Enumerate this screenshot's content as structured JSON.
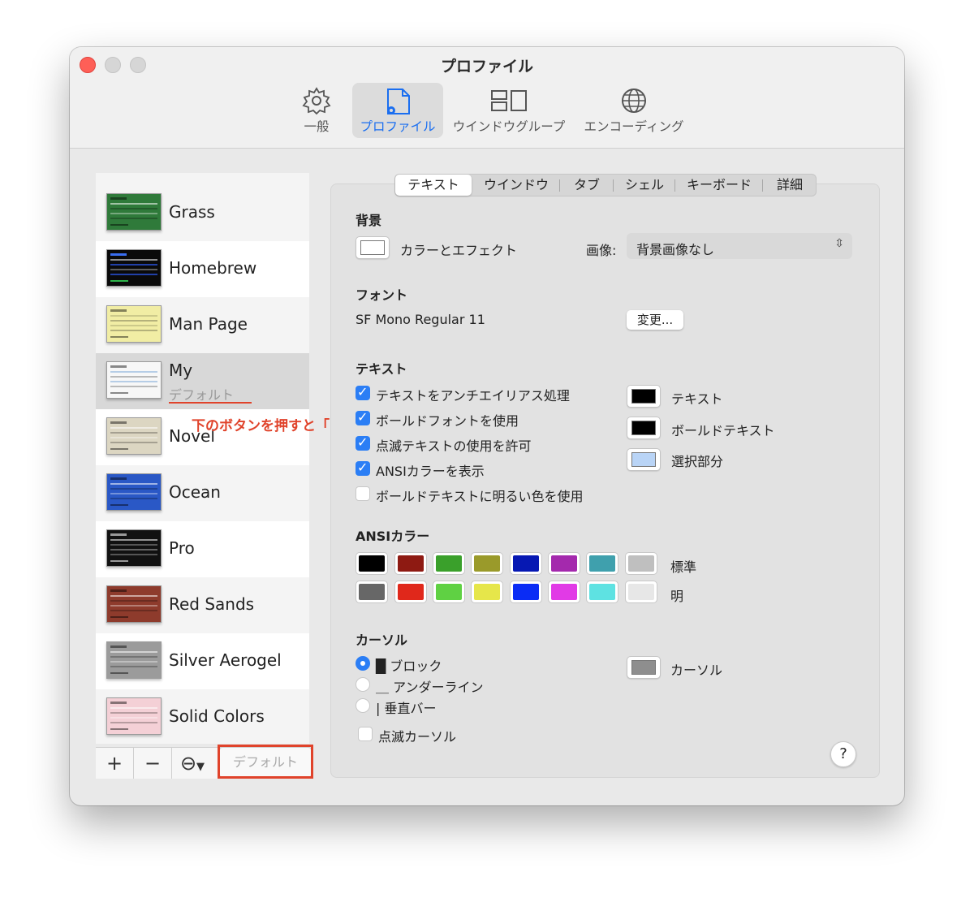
{
  "window": {
    "title": "プロファイル"
  },
  "toolbar": {
    "items": [
      {
        "label": "一般",
        "icon": "gear-icon"
      },
      {
        "label": "プロファイル",
        "icon": "profile-doc-icon",
        "active": true
      },
      {
        "label": "ウインドウグループ",
        "icon": "window-groups-icon"
      },
      {
        "label": "エンコーディング",
        "icon": "globe-icon"
      }
    ]
  },
  "sidebar": {
    "profiles": [
      {
        "name": "Grass",
        "color": "#2f7a3a"
      },
      {
        "name": "Homebrew",
        "color": "#0a0a0a"
      },
      {
        "name": "Man Page",
        "color": "#f1eda4"
      },
      {
        "name": "My",
        "sub": "デフォルト",
        "color": "#f7f7f7",
        "selected": true
      },
      {
        "name": "Novel",
        "color": "#dcd6c2"
      },
      {
        "name": "Ocean",
        "color": "#2a58c6"
      },
      {
        "name": "Pro",
        "color": "#111111"
      },
      {
        "name": "Red Sands",
        "color": "#8e3b2c"
      },
      {
        "name": "Silver Aerogel",
        "color": "#9b9b9b"
      },
      {
        "name": "Solid Colors",
        "color": "#f4d0d6"
      }
    ],
    "add_label": "+",
    "remove_label": "−",
    "more_label": "⊖",
    "default_button": "デフォルト"
  },
  "annotation": "下のボタンを押すと「デフォルト」と表示される",
  "tabs": [
    "テキスト",
    "ウインドウ",
    "タブ",
    "シェル",
    "キーボード",
    "詳細"
  ],
  "background": {
    "heading": "背景",
    "color_effect": "カラーとエフェクト",
    "image_label": "画像:",
    "image_value": "背景画像なし"
  },
  "font": {
    "heading": "フォント",
    "name": "SF Mono Regular 11",
    "change_button": "変更..."
  },
  "text": {
    "heading": "テキスト",
    "options": [
      {
        "label": "テキストをアンチエイリアス処理",
        "checked": true
      },
      {
        "label": "ボールドフォントを使用",
        "checked": true
      },
      {
        "label": "点滅テキストの使用を許可",
        "checked": true
      },
      {
        "label": "ANSIカラーを表示",
        "checked": true
      },
      {
        "label": "ボールドテキストに明るい色を使用",
        "checked": false
      }
    ],
    "colors": [
      {
        "label": "テキスト",
        "color": "#000000"
      },
      {
        "label": "ボールドテキスト",
        "color": "#000000"
      },
      {
        "label": "選択部分",
        "color": "#b9d4f6"
      }
    ]
  },
  "ansi": {
    "heading": "ANSIカラー",
    "normal_label": "標準",
    "bright_label": "明",
    "normal": [
      "#000000",
      "#8e1a12",
      "#3aa02b",
      "#9a9a2a",
      "#0618b3",
      "#a429ad",
      "#3fa0ad",
      "#bfbfbf"
    ],
    "bright": [
      "#676767",
      "#e0281b",
      "#5fd143",
      "#e6e64a",
      "#0a2cf5",
      "#e13ae6",
      "#5ee2e2",
      "#e7e7e7"
    ]
  },
  "cursor": {
    "heading": "カーソル",
    "options": [
      {
        "label": "█ ブロック",
        "selected": true
      },
      {
        "label": "＿ アンダーライン",
        "selected": false
      },
      {
        "label": "| 垂直バー",
        "selected": false
      }
    ],
    "blink_label": "点滅カーソル",
    "color_label": "カーソル",
    "color": "#8e8e8e"
  },
  "help_label": "?"
}
